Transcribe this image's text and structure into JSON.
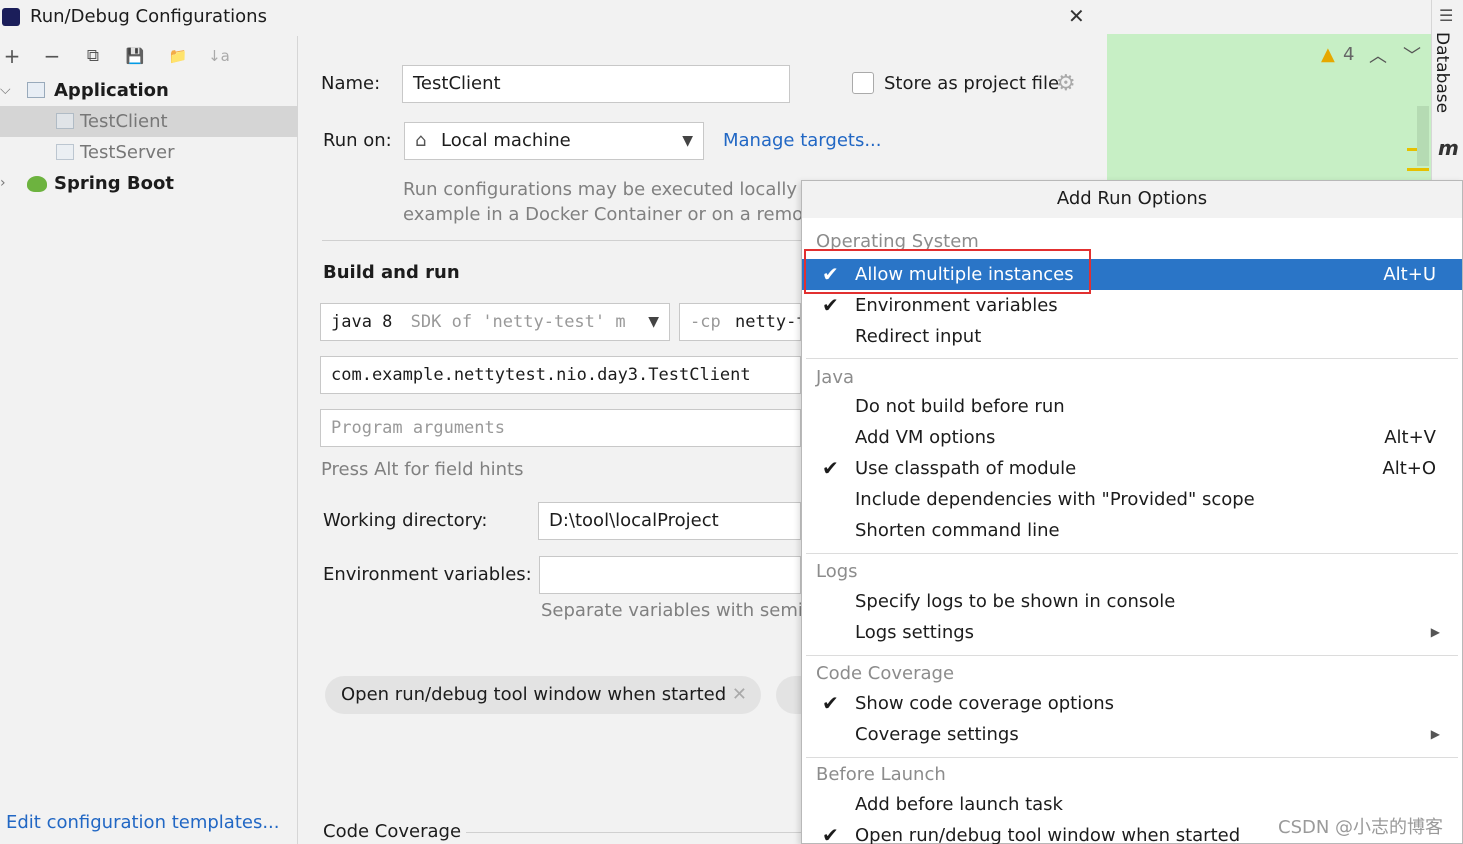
{
  "window": {
    "title": "Run/Debug Configurations",
    "close": "✕"
  },
  "toolbar": {
    "add": "+",
    "remove": "−",
    "copy": "⧉",
    "save": "💾",
    "folder": "📁",
    "sort": "↓a"
  },
  "tree": {
    "application": "Application",
    "items": [
      "TestClient",
      "TestServer"
    ],
    "spring_boot": "Spring Boot"
  },
  "edit_templates": "Edit configuration templates...",
  "form": {
    "name_label": "Name:",
    "name_value": "TestClient",
    "store_label": "Store as project file",
    "run_on_label": "Run on:",
    "run_on_value": "Local machine",
    "manage_targets": "Manage targets...",
    "run_hint_1": "Run configurations may be executed locally or",
    "run_hint_2": "example in a Docker Container or on a remote",
    "build_run": "Build and run",
    "jdk_java": "java 8",
    "jdk_sdk": "SDK of 'netty-test' m",
    "cp_flag": "-cp",
    "cp_value": "netty-t",
    "main_class": "com.example.nettytest.nio.day3.TestClient",
    "program_args_placeholder": "Program arguments",
    "alt_hint": "Press Alt for field hints",
    "wd_label": "Working directory:",
    "wd_value": "D:\\tool\\localProject",
    "env_label": "Environment variables:",
    "env_hint": "Separate variables with semico",
    "chip_open": "Open run/debug tool window when started",
    "code_coverage": "Code Coverage"
  },
  "editor": {
    "warnings": "4",
    "sidebar_label": "Database",
    "m_label": "m"
  },
  "popup": {
    "title": "Add Run Options",
    "sections": [
      {
        "name": "Operating System",
        "items": [
          {
            "label": "Allow multiple instances",
            "checked": true,
            "shortcut": "Alt+U",
            "highlighted": true
          },
          {
            "label": "Environment variables",
            "checked": true,
            "shortcut": ""
          },
          {
            "label": "Redirect input",
            "checked": false,
            "shortcut": ""
          }
        ]
      },
      {
        "name": "Java",
        "items": [
          {
            "label": "Do not build before run",
            "checked": false,
            "shortcut": ""
          },
          {
            "label": "Add VM options",
            "checked": false,
            "shortcut": "Alt+V"
          },
          {
            "label": "Use classpath of module",
            "checked": true,
            "shortcut": "Alt+O"
          },
          {
            "label": "Include dependencies with \"Provided\" scope",
            "checked": false,
            "shortcut": ""
          },
          {
            "label": "Shorten command line",
            "checked": false,
            "shortcut": ""
          }
        ]
      },
      {
        "name": "Logs",
        "items": [
          {
            "label": "Specify logs to be shown in console",
            "checked": false,
            "shortcut": ""
          },
          {
            "label": "Logs settings",
            "checked": false,
            "shortcut": "",
            "submenu": true
          }
        ]
      },
      {
        "name": "Code Coverage",
        "items": [
          {
            "label": "Show code coverage options",
            "checked": true,
            "shortcut": ""
          },
          {
            "label": "Coverage settings",
            "checked": false,
            "shortcut": "",
            "submenu": true
          }
        ]
      },
      {
        "name": "Before Launch",
        "items": [
          {
            "label": "Add before launch task",
            "checked": false,
            "shortcut": ""
          },
          {
            "label": "Open run/debug tool window when started",
            "checked": true,
            "shortcut": ""
          }
        ]
      }
    ]
  },
  "watermark": "CSDN @小志的博客",
  "colors": {
    "accent": "#2a75c7",
    "link": "#2167c4",
    "highlight_box": "#e23030",
    "editor_bg": "#c7efc5"
  }
}
